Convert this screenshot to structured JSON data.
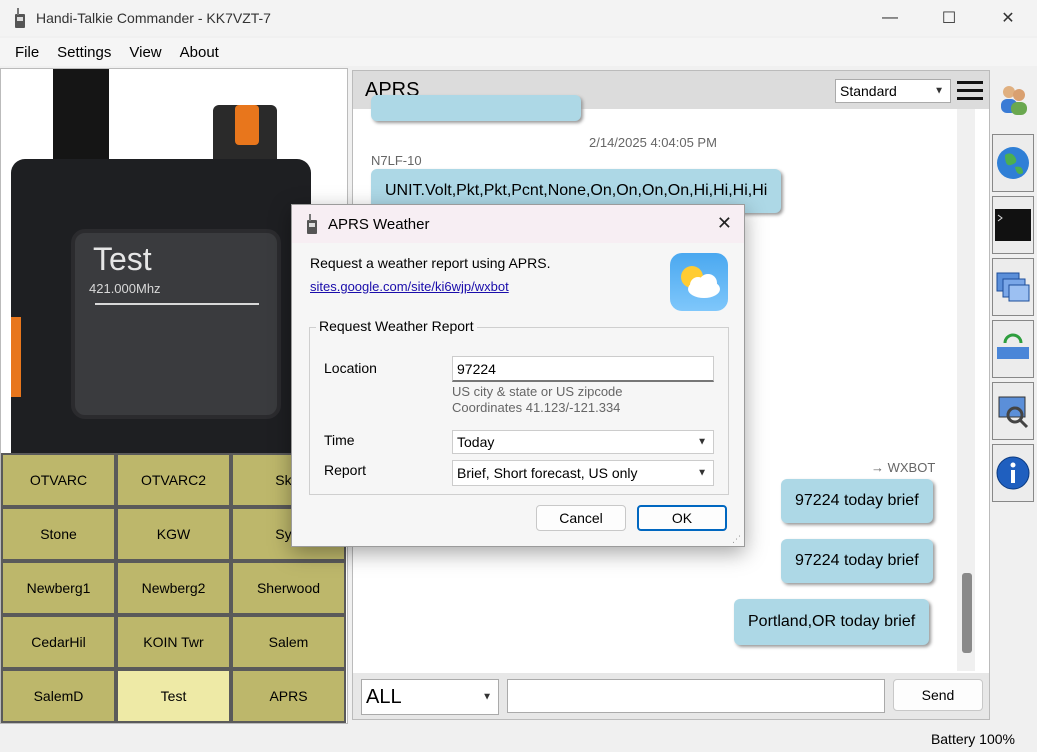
{
  "window": {
    "title": "Handi-Talkie Commander - KK7VZT-7",
    "minimize": "—",
    "maximize": "☐",
    "close": "✕"
  },
  "menu": [
    "File",
    "Settings",
    "View",
    "About"
  ],
  "radio": {
    "screen_label": "Test",
    "frequency": "421.000Mhz"
  },
  "channels": [
    {
      "label": "OTVARC",
      "active": false
    },
    {
      "label": "OTVARC2",
      "active": false
    },
    {
      "label": "Skyl",
      "active": false
    },
    {
      "label": "Stone",
      "active": false
    },
    {
      "label": "KGW",
      "active": false
    },
    {
      "label": "Sylv",
      "active": false
    },
    {
      "label": "Newberg1",
      "active": false
    },
    {
      "label": "Newberg2",
      "active": false
    },
    {
      "label": "Sherwood",
      "active": false
    },
    {
      "label": "CedarHil",
      "active": false
    },
    {
      "label": "KOIN Twr",
      "active": false
    },
    {
      "label": "Salem",
      "active": false
    },
    {
      "label": "SalemD",
      "active": false
    },
    {
      "label": "Test",
      "active": true
    },
    {
      "label": "APRS",
      "active": false
    }
  ],
  "aprs": {
    "title": "APRS",
    "view_mode": "Standard",
    "timestamp": "2/14/2025 4:04:05 PM",
    "sender": "N7LF-10",
    "incoming_message": "UNIT.Volt,Pkt,Pkt,Pcnt,None,On,On,On,On,Hi,Hi,Hi,Hi",
    "recipient": "→ WXBOT",
    "outgoing": [
      "97224 today brief",
      "97224 today brief",
      "Portland,OR today brief"
    ],
    "footer": {
      "channel_select": "ALL",
      "message_value": "",
      "send_label": "Send"
    }
  },
  "dialog": {
    "title": "APRS Weather",
    "close": "✕",
    "description": "Request a weather report using APRS.",
    "link": "sites.google.com/site/ki6wjp/wxbot",
    "group_title": "Request Weather Report",
    "location_label": "Location",
    "location_value": "97224",
    "hint1": "US city & state or US zipcode",
    "hint2": "Coordinates 41.123/-121.334",
    "time_label": "Time",
    "time_value": "Today",
    "report_label": "Report",
    "report_value": "Brief, Short forecast, US only",
    "cancel_label": "Cancel",
    "ok_label": "OK"
  },
  "status": {
    "battery": "Battery 100%"
  },
  "toolbar_icons": [
    "users-icon",
    "globe-icon",
    "terminal-icon",
    "windows-icon",
    "network-refresh-icon",
    "search-monitor-icon",
    "info-icon"
  ],
  "colors": {
    "channel": "#bdb76b",
    "channel_active": "#eeeaa6",
    "bubble": "#add8e6",
    "ok_border": "#0067c0"
  }
}
